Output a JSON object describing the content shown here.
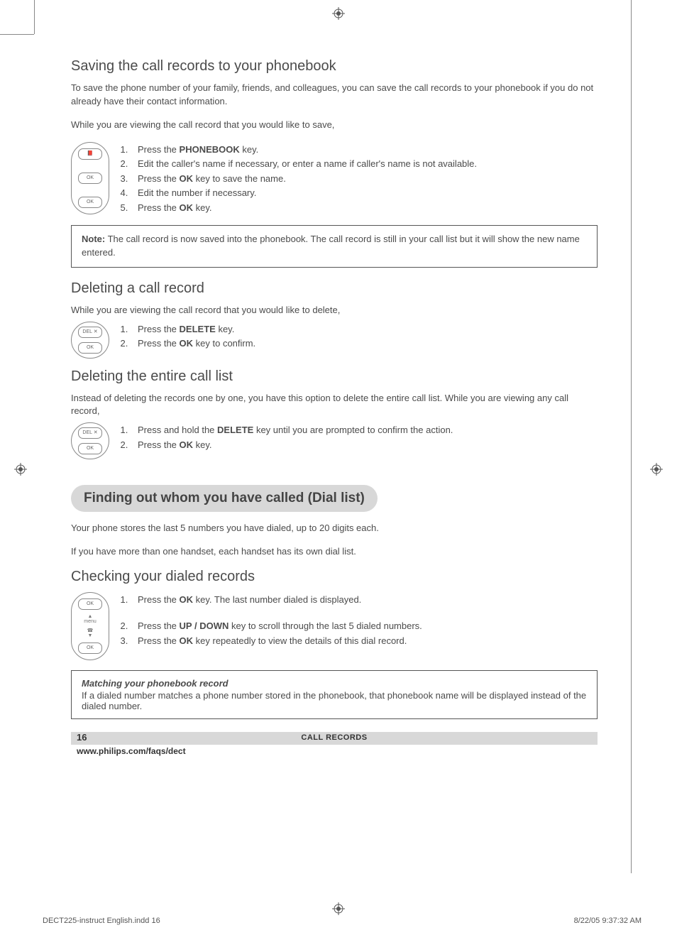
{
  "sec1": {
    "heading": "Saving the call records to your phonebook",
    "intro": "To save the phone number of your family, friends, and colleagues, you can save the call records to your phonebook if you do not already have their contact information.",
    "lead": "While you are viewing the call record that you would like to save,",
    "keys": {
      "k1": "📕",
      "k2": "OK",
      "k3": "OK"
    },
    "steps": {
      "s1a": "Press the ",
      "s1b": "PHONEBOOK",
      "s1c": " key.",
      "s2": "Edit the caller's name if necessary, or enter a name if caller's name is not available.",
      "s3a": "Press the ",
      "s3b": "OK",
      "s3c": " key to save the name.",
      "s4": "Edit the number if necessary.",
      "s5a": "Press the ",
      "s5b": "OK",
      "s5c": " key."
    },
    "note": {
      "label": "Note:",
      "text": "  The call record is now saved into the phonebook.  The call record is still in your call list but it will show the new name entered."
    }
  },
  "sec2": {
    "heading": "Deleting a call record",
    "lead": "While you are viewing the call record that you would like to delete,",
    "keys": {
      "k1": "DEL ✕",
      "k2": "OK"
    },
    "steps": {
      "s1a": "Press the ",
      "s1b": "DELETE",
      "s1c": " key.",
      "s2a": "Press the ",
      "s2b": "OK",
      "s2c": " key to confirm."
    }
  },
  "sec3": {
    "heading": "Deleting the entire call list",
    "lead": "Instead of deleting the records one by one, you have this option to delete the entire call list.  While you are viewing any call record,",
    "keys": {
      "k1": "DEL ✕",
      "k2": "OK"
    },
    "steps": {
      "s1a": "Press and hold the ",
      "s1b": "DELETE",
      "s1c": " key until you are prompted to confirm the action.",
      "s2a": "Press the ",
      "s2b": "OK",
      "s2c": " key."
    }
  },
  "band": {
    "heading": "Finding out whom you have called (Dial list)",
    "p1": "Your phone stores the last 5 numbers you have dialed, up to 20 digits each.",
    "p2": "If you have more than one handset, each handset has its own dial list."
  },
  "sec4": {
    "heading": "Checking your dialed records",
    "keys": {
      "k1": "OK",
      "mid1": "▲\nmenu",
      "mid2": "☎\n▼",
      "k2": "OK"
    },
    "steps": {
      "s1a": "Press the ",
      "s1b": "OK",
      "s1c": " key.  The last number dialed is displayed.",
      "s2a": "Press the ",
      "s2b": "UP / DOWN",
      "s2c": " key to scroll through the last 5 dialed numbers.",
      "s3a": "Press the ",
      "s3b": "OK",
      "s3c": " key repeatedly to view the details of this dial record."
    }
  },
  "infobox": {
    "title": "Matching your phonebook record",
    "body": "If a dialed number matches a phone number stored in the phonebook, that phonebook name will be displayed instead of the dialed number."
  },
  "footer": {
    "pagenum": "16",
    "title": "CALL RECORDS",
    "url": "www.philips.com/faqs/dect"
  },
  "indd": {
    "left": "DECT225-instruct English.indd   16",
    "right": "8/22/05   9:37:32 AM"
  }
}
